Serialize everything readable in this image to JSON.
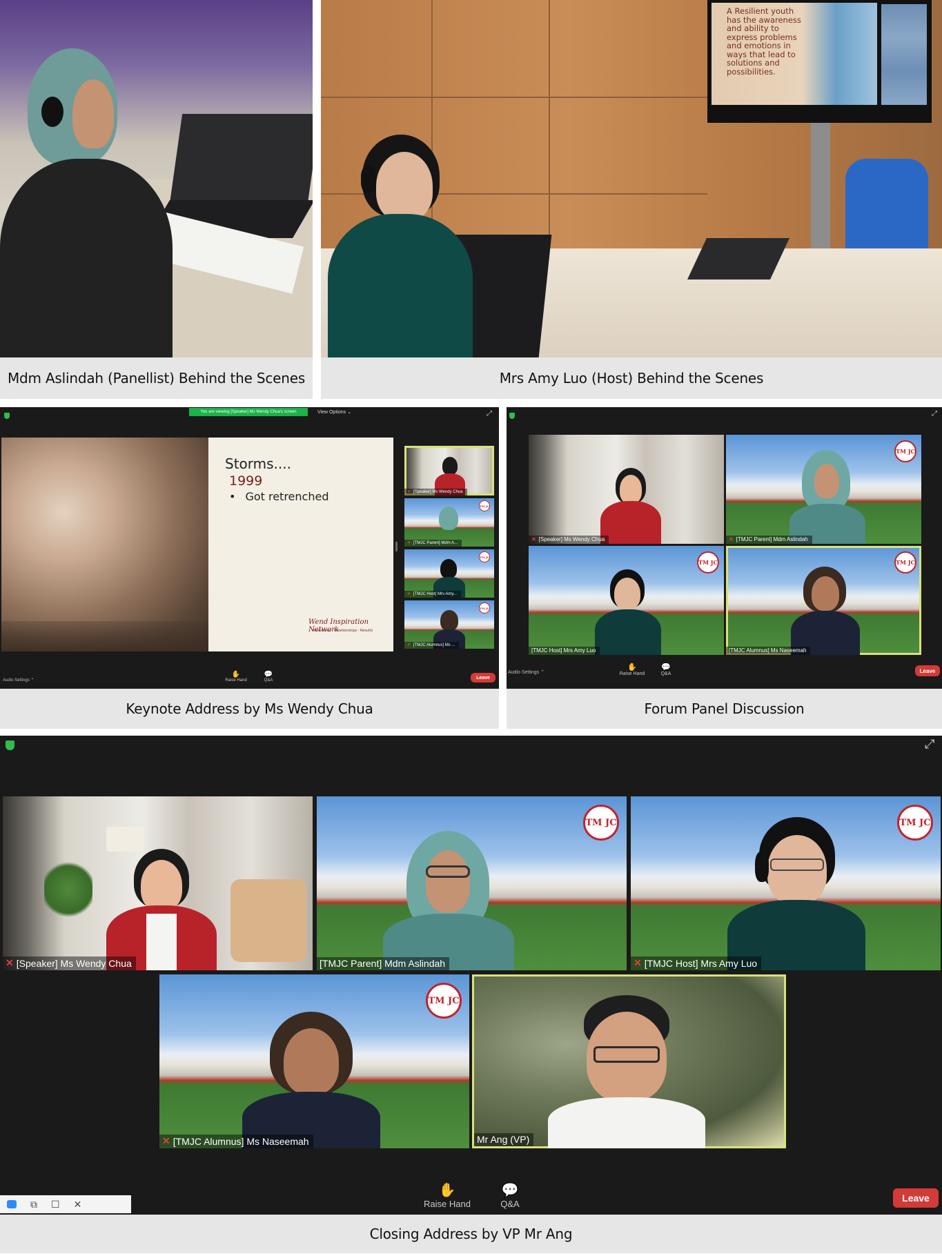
{
  "captions": {
    "top_left": "Mdm Aslindah (Panellist) Behind the Scenes",
    "top_right": "Mrs Amy Luo (Host) Behind the Scenes",
    "mid_left": "Keynote Address by Ms Wendy Chua",
    "mid_right": "Forum Panel Discussion",
    "bottom": "Closing Address by VP Mr Ang"
  },
  "tv_slide": {
    "quote": "A Resilient youth has the awareness and ability to express problems and emotions in ways that lead to solutions and possibilities."
  },
  "keynote": {
    "share_banner": "You are viewing [Speaker] Ms Wendy Chua's screen",
    "view_options": "View Options",
    "slide_title": "Storms....",
    "slide_year": "1999",
    "slide_bullet": "Got retrenched",
    "slide_logo": "Wend Inspiration Network",
    "slide_logo_sub": "Resilience · Relationships · Results",
    "thumbs": [
      {
        "label": "[Speaker] Ms Wendy Chua"
      },
      {
        "label": "[TMJC Parent] Mdm A..."
      },
      {
        "label": "[TMJC Host] Mrs Amy..."
      },
      {
        "label": "[TMJC Alumnus] Ms ..."
      }
    ],
    "audio_settings": "Audio Settings",
    "raise_hand": "Raise Hand",
    "qa": "Q&A",
    "leave": "Leave"
  },
  "forum": {
    "tiles": [
      {
        "label": "[Speaker] Ms Wendy Chua"
      },
      {
        "label": "[TMJC Parent] Mdm Aslindah"
      },
      {
        "label": "[TMJC Host] Mrs Amy Luo"
      },
      {
        "label": "[TMJC Alumnus] Ms Naseemah"
      }
    ],
    "audio_settings": "Audio Settings",
    "raise_hand": "Raise Hand",
    "qa": "Q&A",
    "leave": "Leave"
  },
  "closing": {
    "tiles": [
      {
        "label": "[Speaker] Ms Wendy Chua"
      },
      {
        "label": "[TMJC Parent] Mdm Aslindah"
      },
      {
        "label": "[TMJC Host] Mrs Amy Luo"
      },
      {
        "label": "[TMJC Alumnus] Ms Naseemah"
      },
      {
        "label": "Mr Ang (VP)"
      }
    ],
    "raise_hand": "Raise Hand",
    "qa": "Q&A",
    "leave": "Leave"
  },
  "crest_text": "TM JC",
  "colors": {
    "zoom_bg": "#1a1a1a",
    "leave_red": "#d23b37",
    "active_speaker": "#d9e27a",
    "caption_bg": "#e6e6e6",
    "crest_red": "#c2232b"
  },
  "icons": {
    "security": "shield-icon",
    "fullscreen": "expand-icon",
    "raise_hand": "hand-icon",
    "qa": "chat-bubbles-icon",
    "muted": "mic-off-icon"
  }
}
